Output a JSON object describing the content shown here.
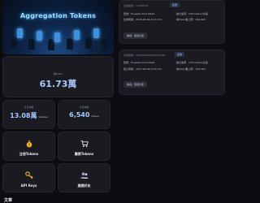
{
  "banner": {
    "title": "Aggregation Tokens"
  },
  "balance": {
    "label": "總Token",
    "value": "61.73萬"
  },
  "stats": [
    {
      "label": "今日消耗",
      "value": "13.08萬",
      "unit": "tokens"
    },
    {
      "label": "今日請求",
      "value": "6,540",
      "unit": "times"
    }
  ],
  "actions": [
    {
      "label": "注冊Tokens",
      "icon": "money-bag-icon"
    },
    {
      "label": "購買Tokens",
      "icon": "cart-icon"
    },
    {
      "label": "API Keys",
      "icon": "key-icon"
    },
    {
      "label": "邀請好友",
      "icon": "friends-icon"
    }
  ],
  "bottom_label": "文章",
  "orders": [
    {
      "header": "訂單編號：12345678",
      "badge": "生效",
      "model_label": "型號：Huawei/cloud MaaS",
      "quota_label": "讓分速率：100 tokens/分鐘",
      "start_label": "生效時間：2026-05-06 03:01:31",
      "limit_label": "總Token數上限：382,900",
      "button": "購買；使用訂單"
    },
    {
      "header": "訂單編號：2024050600000123456",
      "badge": "生效",
      "model_label": "型號：Huawei/cloud MaaS",
      "quota_label": "讓分速率：100 tokens/分鐘",
      "start_label": "截止時間：2027-05-06 03:01:31",
      "limit_label": "總Token數上限：303,309",
      "button": "購買；使用訂單"
    }
  ]
}
